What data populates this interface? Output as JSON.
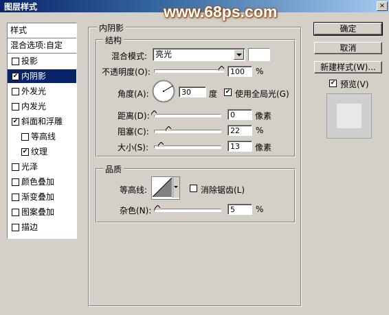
{
  "window": {
    "title": "图层样式",
    "close_icon": "×"
  },
  "watermark": "www.68ps.com",
  "sidebar": {
    "items": [
      {
        "label": "样式",
        "checkbox": false,
        "checked": false,
        "selected": false
      },
      {
        "label": "混合选项:自定",
        "checkbox": false,
        "checked": false,
        "selected": false
      },
      {
        "label": "投影",
        "checkbox": true,
        "checked": false,
        "selected": false
      },
      {
        "label": "内阴影",
        "checkbox": true,
        "checked": true,
        "selected": true
      },
      {
        "label": "外发光",
        "checkbox": true,
        "checked": false,
        "selected": false
      },
      {
        "label": "内发光",
        "checkbox": true,
        "checked": false,
        "selected": false
      },
      {
        "label": "斜面和浮雕",
        "checkbox": true,
        "checked": true,
        "selected": false
      },
      {
        "label": "等高线",
        "checkbox": true,
        "checked": false,
        "selected": false
      },
      {
        "label": "纹理",
        "checkbox": true,
        "checked": true,
        "selected": false
      },
      {
        "label": "光泽",
        "checkbox": true,
        "checked": false,
        "selected": false
      },
      {
        "label": "颜色叠加",
        "checkbox": true,
        "checked": false,
        "selected": false
      },
      {
        "label": "渐变叠加",
        "checkbox": true,
        "checked": false,
        "selected": false
      },
      {
        "label": "图案叠加",
        "checkbox": true,
        "checked": false,
        "selected": false
      },
      {
        "label": "描边",
        "checkbox": true,
        "checked": false,
        "selected": false
      }
    ]
  },
  "inner_shadow": {
    "section_title": "内阴影",
    "structure": {
      "title": "结构",
      "blend_mode_label": "混合模式:",
      "blend_mode_value": "亮光",
      "opacity_label": "不透明度(O):",
      "opacity_value": "100",
      "opacity_unit": "%",
      "angle_label": "角度(A):",
      "angle_value": "30",
      "angle_unit": "度",
      "global_light_label": "使用全局光(G)",
      "global_light_checked": true,
      "distance_label": "距离(D):",
      "distance_value": "0",
      "distance_unit": "像素",
      "choke_label": "阻塞(C):",
      "choke_value": "22",
      "choke_unit": "%",
      "size_label": "大小(S):",
      "size_value": "13",
      "size_unit": "像素"
    },
    "quality": {
      "title": "品质",
      "contour_label": "等高线:",
      "anti_alias_label": "消除锯齿(L)",
      "anti_alias_checked": false,
      "noise_label": "杂色(N):",
      "noise_value": "5",
      "noise_unit": "%"
    }
  },
  "buttons": {
    "ok": "确定",
    "cancel": "取消",
    "new_style": "新建样式(W)...",
    "preview_label": "预览(V)",
    "preview_checked": true
  },
  "colors": {
    "title_bar": "#0a246a",
    "selection": "#0a246a",
    "dialog_bg": "#d4d0c8"
  }
}
